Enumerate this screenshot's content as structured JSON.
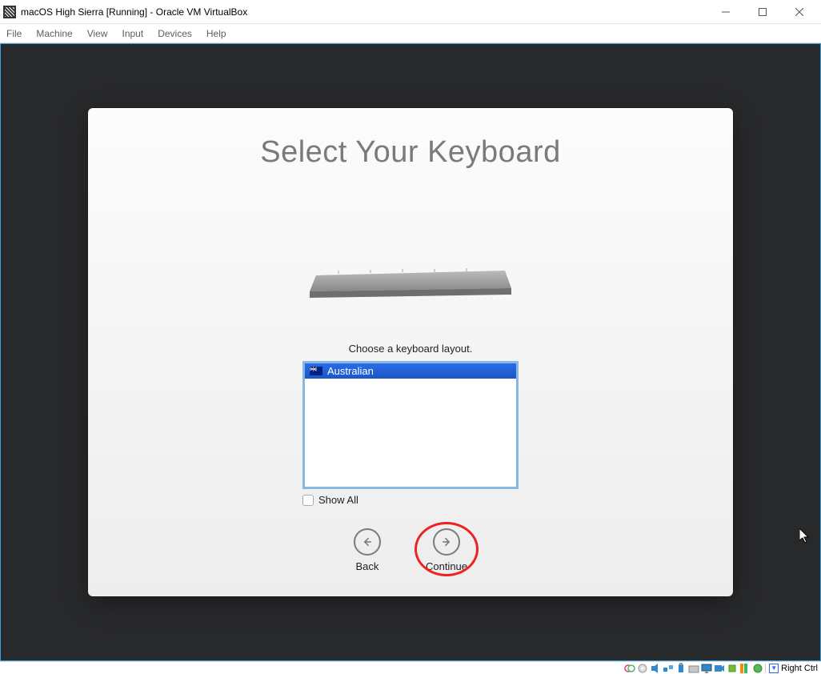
{
  "window": {
    "title": "macOS High Sierra [Running] - Oracle VM VirtualBox",
    "controls": {
      "minimize": "minimize",
      "maximize": "maximize",
      "close": "close"
    }
  },
  "menu": {
    "file": "File",
    "machine": "Machine",
    "view": "View",
    "input": "Input",
    "devices": "Devices",
    "help": "Help"
  },
  "installer": {
    "title": "Select Your Keyboard",
    "choose_label": "Choose a keyboard layout.",
    "layouts": [
      {
        "name": "Australian",
        "flag": "au",
        "selected": true
      }
    ],
    "show_all_label": "Show All",
    "show_all_checked": false,
    "back_label": "Back",
    "continue_label": "Continue"
  },
  "statusbar": {
    "host_key": "Right Ctrl"
  }
}
